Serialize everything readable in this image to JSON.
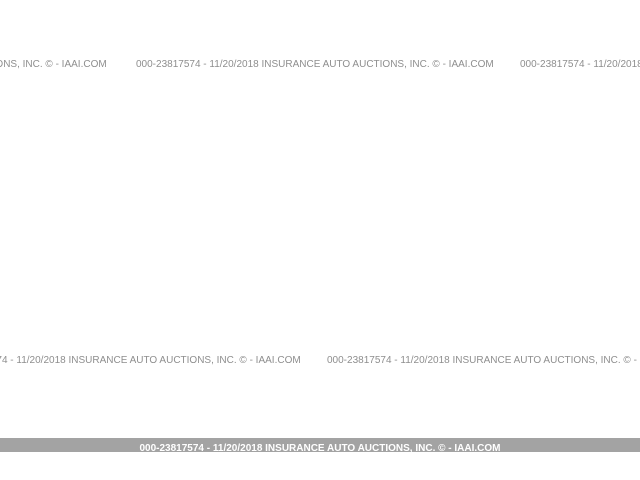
{
  "watermark": {
    "text": "000-23817574 - 11/20/2018 INSURANCE AUTO AUCTIONS, INC. © - IAAI.COM"
  },
  "footer": {
    "text": "000-23817574 - 11/20/2018 INSURANCE AUTO AUCTIONS, INC. © - IAAI.COM",
    "background": "#a3a3a3",
    "text_color": "#ffffff"
  },
  "colors": {
    "page_background": "#ffffff",
    "watermark_text": "#8e8e8e"
  }
}
